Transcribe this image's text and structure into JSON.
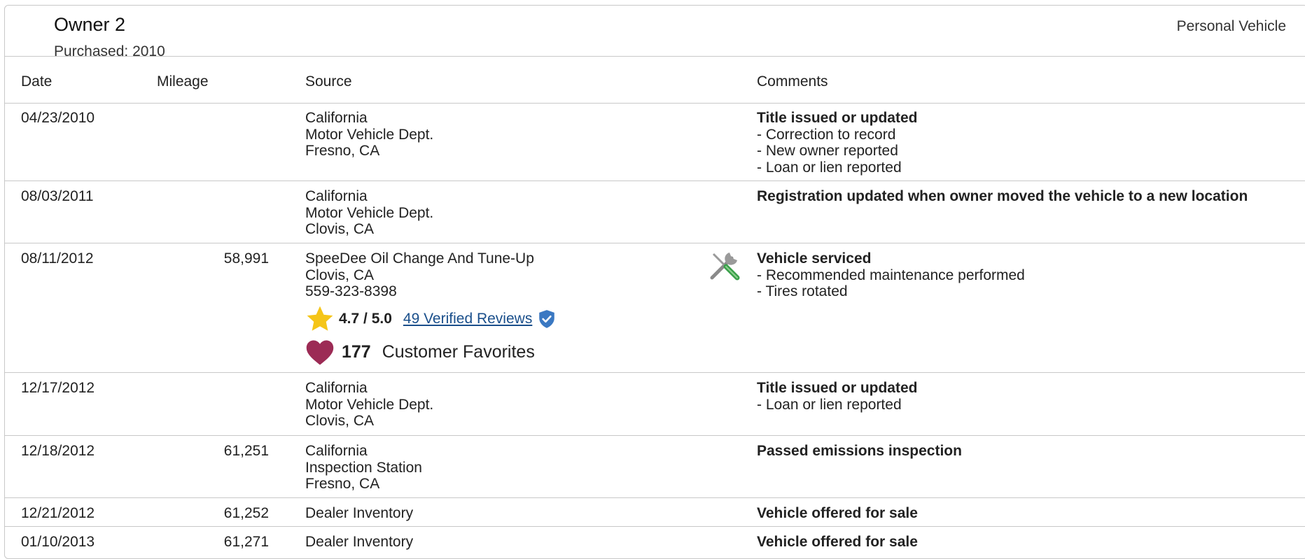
{
  "owner": {
    "title": "Owner 2",
    "purchased": "Purchased: 2010",
    "vehicle_type": "Personal Vehicle"
  },
  "table": {
    "headers": [
      "Date",
      "Mileage",
      "Source",
      "Comments"
    ],
    "rows": [
      {
        "date": "04/23/2010",
        "mileage": "",
        "source": [
          "California",
          "Motor Vehicle Dept.",
          "Fresno, CA"
        ],
        "comment_title": "Title issued or updated",
        "comment_details": [
          "- Correction to record",
          "- New owner reported",
          "- Loan or lien reported"
        ]
      },
      {
        "date": "08/03/2011",
        "mileage": "",
        "source": [
          "California",
          "Motor Vehicle Dept.",
          "Clovis, CA"
        ],
        "comment_title": "Registration updated when owner moved the vehicle to a new location",
        "comment_details": []
      },
      {
        "date": "08/11/2012",
        "mileage": "58,991",
        "source": [
          "SpeeDee Oil Change And Tune-Up",
          "Clovis, CA",
          "559-323-8398"
        ],
        "rating": "4.7 / 5.0",
        "reviews": "49 Verified Reviews",
        "favorites_count": "177",
        "favorites_label": "Customer Favorites",
        "icon": "wrench-screwdriver-icon",
        "comment_title": "Vehicle serviced",
        "comment_details": [
          "- Recommended maintenance performed",
          "- Tires rotated"
        ]
      },
      {
        "date": "12/17/2012",
        "mileage": "",
        "source": [
          "California",
          "Motor Vehicle Dept.",
          "Clovis, CA"
        ],
        "comment_title": "Title issued or updated",
        "comment_details": [
          "- Loan or lien reported"
        ]
      },
      {
        "date": "12/18/2012",
        "mileage": "61,251",
        "source": [
          "California",
          "Inspection Station",
          "Fresno, CA"
        ],
        "comment_title": "Passed emissions inspection",
        "comment_details": []
      },
      {
        "date": "12/21/2012",
        "mileage": "61,252",
        "source": [
          "Dealer Inventory"
        ],
        "comment_title": "Vehicle offered for sale",
        "comment_details": []
      },
      {
        "date": "01/10/2013",
        "mileage": "61,271",
        "source": [
          "Dealer Inventory"
        ],
        "comment_title": "Vehicle offered for sale",
        "comment_details": []
      }
    ]
  },
  "colors": {
    "border": "#c8c8c8",
    "link": "#1a4f8b",
    "star": "#f5c518",
    "heart": "#9c2b55",
    "verified": "#3a78c2"
  }
}
